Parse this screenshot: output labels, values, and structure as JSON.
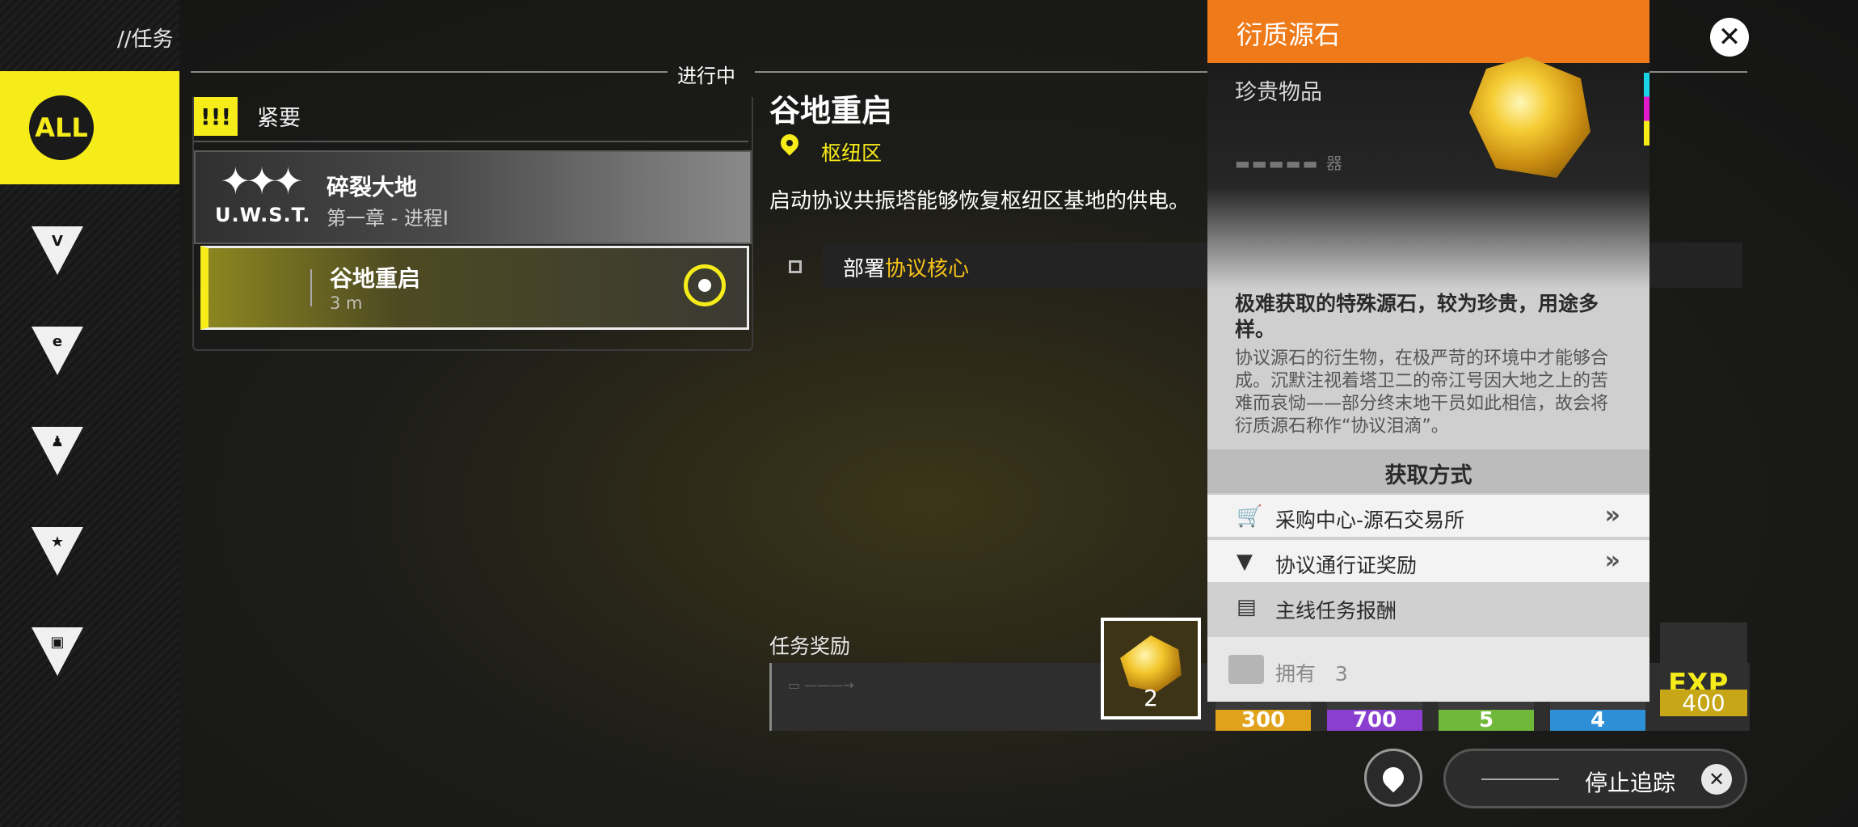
{
  "breadcrumb": "//任务",
  "sidebar": {
    "all_label": "ALL",
    "items": [
      {
        "name": "endfield",
        "glyph": "V"
      },
      {
        "name": "e-category",
        "glyph": "e"
      },
      {
        "name": "person-category",
        "glyph": "♟"
      },
      {
        "name": "star-category",
        "glyph": "★"
      },
      {
        "name": "box-category",
        "glyph": "▣"
      }
    ]
  },
  "quest_list": {
    "tab_label": "进行中",
    "section_icon": "!!!",
    "section_label": "紧要",
    "quests": [
      {
        "logo_text": "U.W.S.T.",
        "title": "碎裂大地",
        "subtitle": "第一章 - 进程I"
      },
      {
        "title": "谷地重启",
        "subtitle": "3 m"
      }
    ]
  },
  "detail": {
    "title": "谷地重启",
    "location": "枢纽区",
    "description": "启动协议共振塔能够恢复枢纽区基地的供电。",
    "objective_prefix": "部署",
    "objective_highlight": "协议核心",
    "rewards_label": "任务奖励",
    "rewards": [
      {
        "count": "2",
        "selected": true
      },
      {
        "count": "300",
        "color": "#e0a21a"
      },
      {
        "count": "700",
        "color": "#8a3fd0"
      },
      {
        "count": "5",
        "color": "#6fb83a"
      },
      {
        "count": "4",
        "color": "#2f8fd6"
      },
      {
        "count": "400",
        "label": "EXP",
        "color": "#c7a618"
      }
    ]
  },
  "popup": {
    "title": "衍质源石",
    "rarity": "珍贵物品",
    "code_mark": "▬▬▬▬▬ 器",
    "description_main": "极难获取的特殊源石，较为珍贵，用途多样。",
    "description_sub": "协议源石的衍生物，在极严苛的环境中才能够合成。沉默注视着塔卫二的帝江号因大地之上的苦难而哀恸——部分终末地干员如此相信，故会将衍质源石称作“协议泪滴”。",
    "acquire_header": "获取方式",
    "sources": [
      {
        "icon": "cart-icon",
        "label": "采购中心-源石交易所",
        "arrow": "»"
      },
      {
        "icon": "pass-icon",
        "label": "协议通行证奖励",
        "arrow": "»"
      },
      {
        "icon": "mission-icon",
        "label": "主线任务报酬",
        "arrow": ""
      }
    ],
    "owned_label": "拥有",
    "owned_count": "3"
  },
  "bottom": {
    "stop_tracking_label": "停止追踪"
  },
  "colors": {
    "accent_yellow": "#f6ec1a",
    "popup_orange": "#ef7a1a"
  }
}
